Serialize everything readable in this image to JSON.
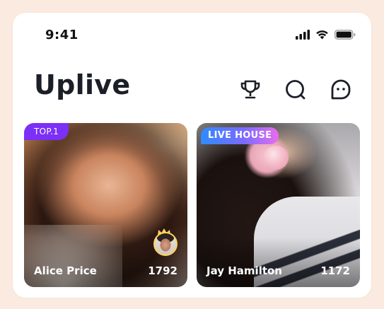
{
  "status_bar": {
    "time": "9:41",
    "icons": [
      "cellular-signal-icon",
      "wifi-icon",
      "battery-icon"
    ]
  },
  "header": {
    "title": "Uplive",
    "actions": [
      "trophy-icon",
      "search-icon",
      "chat-icon"
    ]
  },
  "cards": [
    {
      "badge": "TOP.1",
      "name": "Alice Price",
      "count": "1792",
      "has_host_avatar": true
    },
    {
      "badge": "LIVE HOUSE",
      "name": "Jay Hamilton",
      "count": "1172",
      "has_host_avatar": false
    }
  ],
  "colors": {
    "page_background": "#fbeadf",
    "top_badge": "#7b2ff7",
    "live_badge_start": "#2f8bff",
    "live_badge_end": "#e86cf0",
    "title_text": "#1b1f27",
    "crown": "#ffd25a"
  }
}
